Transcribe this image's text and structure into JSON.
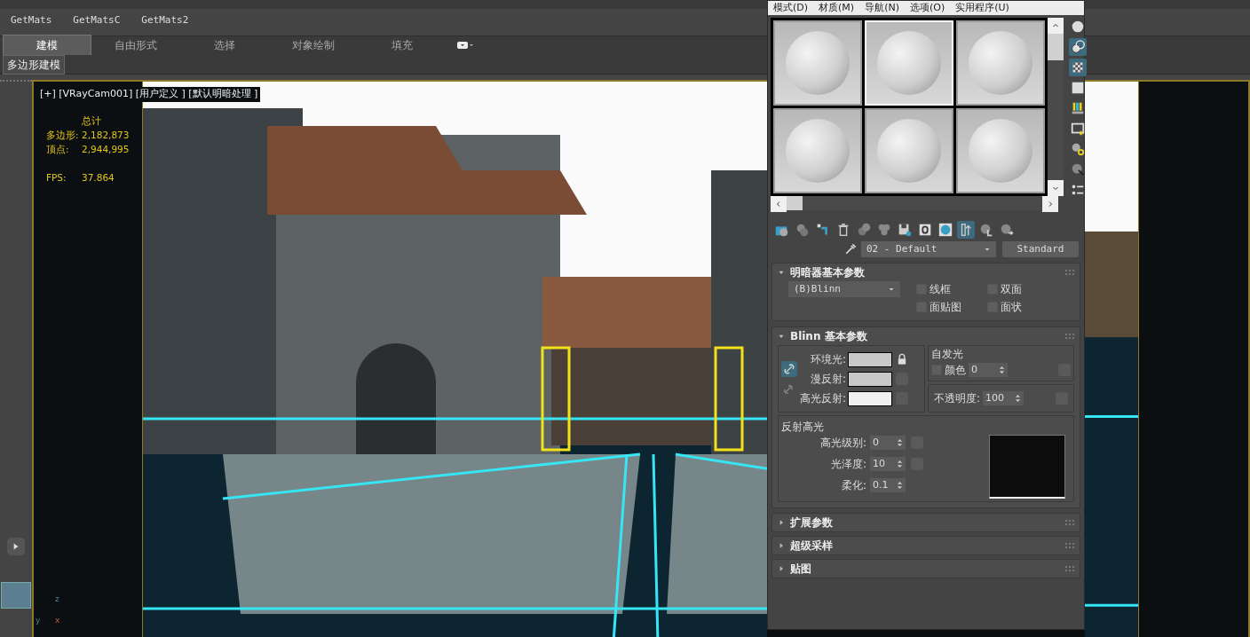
{
  "toolbar": {
    "buttons": [
      "GetMats",
      "GetMatsC",
      "GetMats2"
    ]
  },
  "ribbon": {
    "tabs": [
      {
        "label": "建模",
        "selected": true
      },
      {
        "label": "自由形式",
        "selected": false
      },
      {
        "label": "选择",
        "selected": false
      },
      {
        "label": "对象绘制",
        "selected": false
      },
      {
        "label": "填充",
        "selected": false
      }
    ],
    "subtabs": [
      "多边形建模"
    ]
  },
  "viewport": {
    "label": "[+] [VRayCam001] [用户定义 ] [默认明暗处理 ]",
    "stats": {
      "header": "总计",
      "rows": [
        {
          "label": "多边形:",
          "value": "2,182,873"
        },
        {
          "label": "顶点:",
          "value": "2,944,995"
        }
      ],
      "fps_label": "FPS:",
      "fps_value": "37.864"
    },
    "axis_labels": [
      "z",
      "y",
      "x"
    ]
  },
  "material_editor": {
    "menu": [
      "模式(D)",
      "材质(M)",
      "导航(N)",
      "选项(O)",
      "实用程序(U)"
    ],
    "slots": [
      {
        "selected": false
      },
      {
        "selected": true
      },
      {
        "selected": false
      },
      {
        "selected": false
      },
      {
        "selected": false
      },
      {
        "selected": false
      }
    ],
    "material_name": "02 - Default",
    "material_type": "Standard",
    "shader_rollout": {
      "title": "明暗器基本参数",
      "expanded": true,
      "shader": "(B)Blinn",
      "options": [
        {
          "label": "线框",
          "checked": false
        },
        {
          "label": "双面",
          "checked": false
        },
        {
          "label": "面贴图",
          "checked": false
        },
        {
          "label": "面状",
          "checked": false
        }
      ]
    },
    "blinn_rollout": {
      "title": "Blinn 基本参数",
      "expanded": true,
      "colors": [
        {
          "label": "环境光:",
          "color": "#c8c8c8"
        },
        {
          "label": "漫反射:",
          "color": "#c8c8c8"
        },
        {
          "label": "高光反射:",
          "color": "#f0f0f0"
        }
      ],
      "self_illum": {
        "title": "自发光",
        "label": "颜色",
        "checked": false,
        "value": "0"
      },
      "opacity": {
        "label": "不透明度:",
        "value": "100"
      },
      "specular": {
        "title": "反射高光",
        "fields": [
          {
            "label": "高光级别:",
            "value": "0"
          },
          {
            "label": "光泽度:",
            "value": "10"
          },
          {
            "label": "柔化:",
            "value": "0.1"
          }
        ]
      }
    },
    "collapsed_rollouts": [
      {
        "title": "扩展参数",
        "expanded": false
      },
      {
        "title": "超级采样",
        "expanded": false
      },
      {
        "title": "贴图",
        "expanded": false
      }
    ]
  }
}
